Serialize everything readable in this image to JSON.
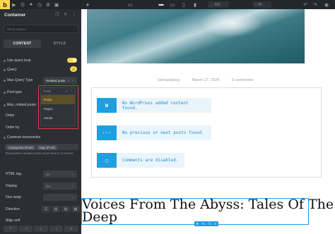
{
  "topbar": {
    "logo": "b",
    "icons": [
      "cursor-icon",
      "layers-icon",
      "info-icon",
      "history-icon",
      "settings-icon",
      "template-icon"
    ],
    "width_value": "992",
    "zoom_value": "86",
    "device_icons": [
      "desktop-icon",
      "tablet-landscape-icon",
      "tablet-icon",
      "mobile-icon"
    ]
  },
  "panel": {
    "title": "Container",
    "css_class_placeholder": "#brxe-wqkeoc",
    "tabs": [
      "CONTENT",
      "STYLE"
    ],
    "controls": {
      "use_query_loop": "Use query loop",
      "query": "Query",
      "max_query_type": "Max Query Type",
      "max_query_type_value": "Related posts",
      "post_type": "Post type",
      "post_type_value": "Posts",
      "max_related_posts": "Max. related posts",
      "order": "Order",
      "order_by": "Order by",
      "common_taxonomies": "Common taxonomies",
      "taxonomy_tags": [
        "Categories (Post)",
        "Tags (Post)"
      ],
      "taxonomy_help": "Taxonomies related posts must have in common.",
      "html_tag": "HTML tag",
      "html_tag_value": "div",
      "display": "Display",
      "display_value": "flex",
      "flex_wrap": "Flex wrap",
      "direction": "Direction",
      "align_self": "Align self"
    },
    "dropdown": {
      "header": "Posts",
      "options": [
        "Posts",
        "Pages",
        "Media"
      ],
      "selected": "Posts"
    }
  },
  "canvas": {
    "meta": [
      "Simranjdeep",
      "March 27, 2024",
      "0 comments"
    ],
    "notices": [
      {
        "icon": "wordpress-icon",
        "text": "No WordPress added content found."
      },
      {
        "icon": "ellipsis-icon",
        "text": "No previous or next posts found."
      },
      {
        "icon": "comments-icon",
        "text": "Comments are disabled."
      }
    ],
    "post_title": "Voices From The Abyss: Tales Of The Deep"
  },
  "colors": {
    "accent": "#ffd64f",
    "panel_bg": "#2b2f34",
    "topbar_bg": "#23272c",
    "notice_blue": "#1e9fe0",
    "highlight_red": "#e13a3a"
  }
}
